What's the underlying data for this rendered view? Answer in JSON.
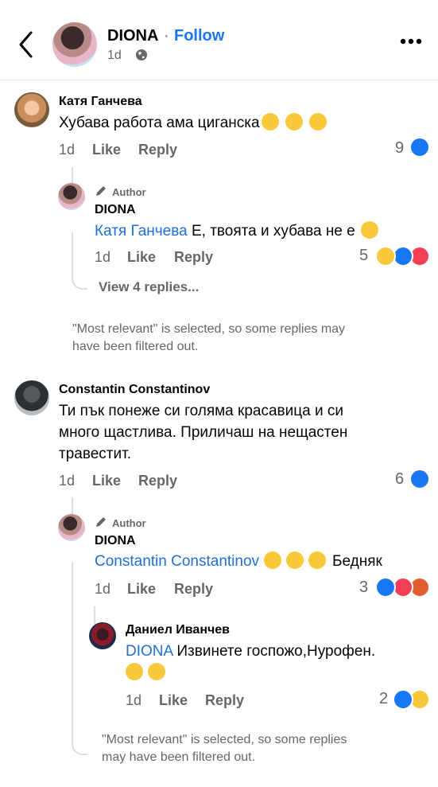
{
  "header": {
    "author_name": "DIONA",
    "separator": "·",
    "follow_label": "Follow",
    "time": "1d"
  },
  "comments": [
    {
      "name": "Катя Ганчева",
      "text": "Хубава работа ама циганска",
      "time": "1d",
      "like": "Like",
      "reply": "Reply",
      "count": "9",
      "reactions": [
        "like"
      ],
      "emojis": [
        "laughing",
        "laughing",
        "laughing"
      ]
    },
    {
      "name": "Constantin Constantinov",
      "lines": [
        "Ти пък понеже си голяма красавица и си",
        "много щастлива. Приличаш на нещастен",
        "травестит."
      ],
      "time": "1d",
      "like": "Like",
      "reply": "Reply",
      "count": "6",
      "reactions": [
        "like"
      ]
    }
  ],
  "replies": [
    {
      "badge": "Author",
      "name": "DIONA",
      "mention": "Катя Ганчева",
      "text": " Е, твоята и хубава не е ",
      "time": "1d",
      "like": "Like",
      "reply": "Reply",
      "count": "5",
      "reactions": [
        "haha",
        "like",
        "heart"
      ],
      "emojis": [
        "grinning"
      ]
    },
    {
      "badge": "Author",
      "name": "DIONA",
      "mention": "Constantin Constantinov",
      "text": "Бедняк",
      "time": "1d",
      "like": "Like",
      "reply": "Reply",
      "count": "3",
      "reactions": [
        "like",
        "heart",
        "angry"
      ],
      "emojis": [
        "rolling",
        "rolling",
        "rolling"
      ]
    },
    {
      "name": "Даниел Иванчев",
      "mention": "DIONA",
      "text": " Извинете госпожо,Нурофен.",
      "time": "1d",
      "like": "Like",
      "reply": "Reply",
      "count": "2",
      "reactions": [
        "like",
        "haha"
      ],
      "emojis": [
        "tears",
        "rolling"
      ]
    }
  ],
  "view_replies": "View 4 replies...",
  "filter_note_1": [
    "\"Most relevant\" is selected, so some replies may",
    "have been filtered out."
  ],
  "filter_note_2": [
    "\"Most relevant\" is selected, so some replies",
    "may have been filtered out."
  ],
  "colors": {
    "accent": "#1877f2",
    "muted": "#65676b"
  }
}
